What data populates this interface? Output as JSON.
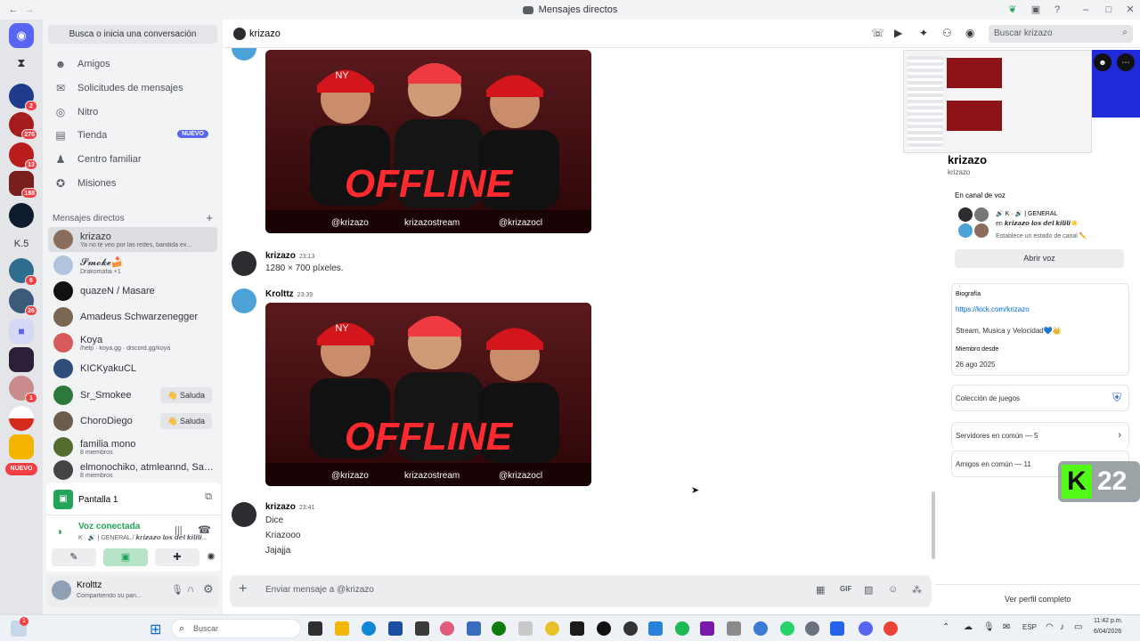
{
  "window": {
    "title": "Mensajes directos"
  },
  "sidebar": {
    "search_label": "Busca o inicia una conversación",
    "nav": [
      {
        "label": "Amigos",
        "icon": "friends-icon"
      },
      {
        "label": "Solicitudes de mensajes",
        "icon": "mail-icon"
      },
      {
        "label": "Nitro",
        "icon": "nitro-icon"
      },
      {
        "label": "Tienda",
        "icon": "shop-icon",
        "badge": "NUEVO"
      },
      {
        "label": "Centro familiar",
        "icon": "family-icon"
      },
      {
        "label": "Misiones",
        "icon": "quest-icon"
      }
    ],
    "dm_header": "Mensajes directos",
    "dms": [
      {
        "name": "krizazo",
        "sub": "Ya no te veo por las redes, bandida ex...",
        "color": "#8a6d5c"
      },
      {
        "name": "𝓢𝓶𝓸𝓴𝓮🍰",
        "sub": "Drakomafia +1",
        "color": "#b0c4de"
      },
      {
        "name": "quazeN / Masare",
        "sub": "",
        "color": "#111"
      },
      {
        "name": "Amadeus Schwarzenegger",
        "sub": "",
        "color": "#7a6653"
      },
      {
        "name": "Koya",
        "sub": "/help · koya.gg · discord.gg/koya",
        "color": "#d65a5a"
      },
      {
        "name": "KICKyakuCL",
        "sub": "",
        "color": "#2e4d7b"
      },
      {
        "name": "Sr_Smokee",
        "sub": "",
        "color": "#2c7a3b",
        "action": "Saluda"
      },
      {
        "name": "ChoroDiego",
        "sub": "",
        "color": "#6e5c4a",
        "action": "Saluda"
      },
      {
        "name": "familia mono",
        "sub": "8 miembros",
        "color": "#556b2f"
      },
      {
        "name": "elmonochiko, atmleannd, Sanc...",
        "sub": "8 miembros",
        "color": "#444"
      }
    ],
    "guild_badges": [
      "2",
      "276",
      "13",
      "188",
      "6",
      "26",
      "1"
    ],
    "guild_label_k5": "K.5",
    "guild_nuevo": "NUEVO"
  },
  "voice": {
    "screen_share": "Pantalla 1",
    "status": "Voz conectada",
    "channel": "K · 🔊 | GENERAL / 𝙠𝙧𝙞𝙯𝙖𝙯𝙤 𝙡𝙤𝙨 𝙙𝙚𝙡 𝙠𝙞𝙡𝙞𝙡𝙞..."
  },
  "user": {
    "name": "Krolttz",
    "status": "Compartiendo su pan..."
  },
  "chat": {
    "recipient": "krizazo",
    "search_placeholder": "Buscar krizazo",
    "banner": {
      "title": "OFFLINE",
      "instagram": "@krizazo",
      "tiktok": "krizazostream",
      "youtube": "@krizazocl",
      "cap": "NY"
    },
    "messages": [
      {
        "author": "krizazo",
        "time": "23:13",
        "lines": [
          "1280 × 700 píxeles."
        ]
      },
      {
        "author": "Krolttz",
        "time": "23:39",
        "lines": []
      },
      {
        "author": "krizazo",
        "time": "23:41",
        "lines": [
          "Dice",
          "Kriazooo",
          "Jajajja"
        ]
      }
    ],
    "composer_placeholder": "Enviar mensaje a @krizazo"
  },
  "profile": {
    "name": "krizazo",
    "username": "krizazo",
    "voice_label": "En canal de voz",
    "voice_server": "🔊 K · 🔊 | GENERAL",
    "voice_channel": "en 𝙠𝙧𝙞𝙯𝙖𝙯𝙤 𝙡𝙤𝙨 𝙙𝙚𝙡 𝙠𝙞𝙡𝙞𝙡𝙞☀️",
    "voice_status": "Establece un estado de canal ✏️",
    "open_voice": "Abrir voz",
    "bio_label": "Biografía",
    "bio_link": "https://kick.com/krizazo",
    "bio_text": "Stream, Musica y Velocidad💙👑",
    "member_label": "Miembro desde",
    "member_date": "26 ago 2025",
    "games": "Colección de juegos",
    "servers": "Servidores en común — 5",
    "friends": "Amigos en común — 11",
    "full_profile": "Ver perfil completo",
    "overlay_number": "22"
  },
  "taskbar": {
    "search": "Buscar",
    "time": "11:42 p.m.",
    "date": "6/04/2026",
    "lang": "ESP",
    "badge": "1"
  }
}
